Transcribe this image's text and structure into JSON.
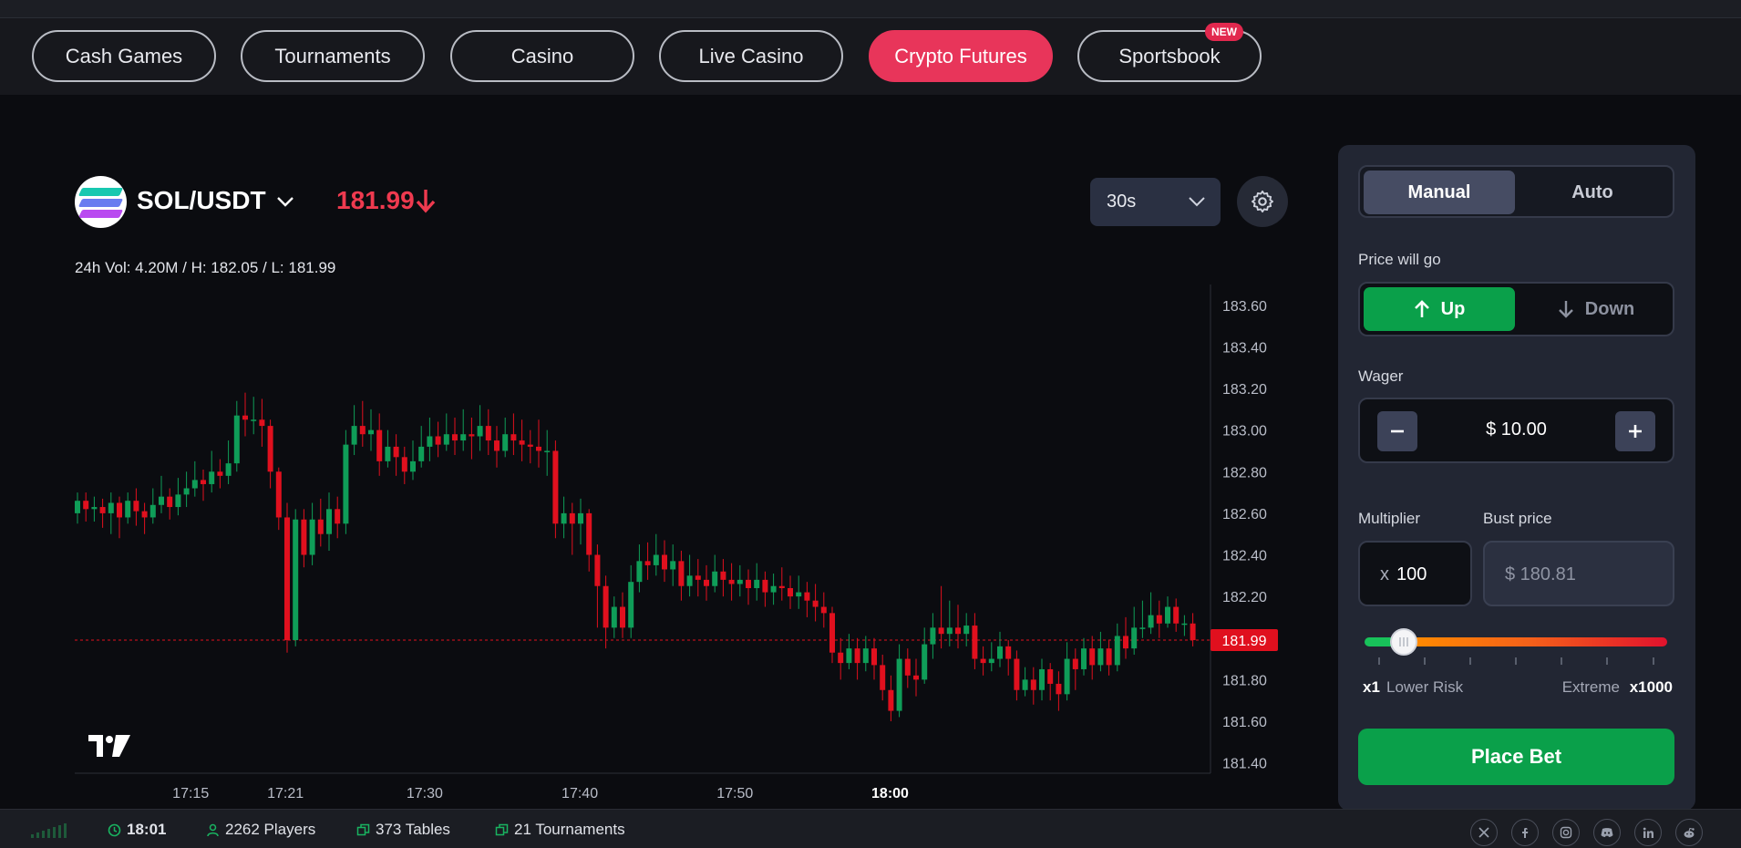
{
  "nav": {
    "tabs": [
      {
        "label": "Cash Games",
        "active": false
      },
      {
        "label": "Tournaments",
        "active": false
      },
      {
        "label": "Casino",
        "active": false
      },
      {
        "label": "Live Casino",
        "active": false
      },
      {
        "label": "Crypto Futures",
        "active": true
      },
      {
        "label": "Sportsbook",
        "active": false,
        "badge": "NEW"
      }
    ]
  },
  "symbol": {
    "pair": "SOL/USDT",
    "price": "181.99",
    "direction": "down",
    "stats": "24h Vol: 4.20M / H: 182.05 / L: 181.99",
    "timeframe": "30s"
  },
  "chart_data": {
    "type": "candlestick",
    "current_price": 181.99,
    "current_price_label": "181.99",
    "ylim": [
      181.35,
      183.7
    ],
    "y_ticks": [
      "183.60",
      "183.40",
      "183.20",
      "183.00",
      "182.80",
      "182.60",
      "182.40",
      "182.20",
      "181.80",
      "181.60",
      "181.40"
    ],
    "x_ticks": [
      {
        "label": "17:15",
        "bold": false
      },
      {
        "label": "17:21",
        "bold": false
      },
      {
        "label": "17:30",
        "bold": false
      },
      {
        "label": "17:40",
        "bold": false
      },
      {
        "label": "17:50",
        "bold": false
      },
      {
        "label": "18:00",
        "bold": true
      }
    ],
    "up_color": "#0f9d58",
    "down_color": "#e0101e",
    "candles": [
      [
        182.6,
        182.66,
        182.7,
        182.55
      ],
      [
        182.66,
        182.62,
        182.7,
        182.56
      ],
      [
        182.62,
        182.63,
        182.68,
        182.56
      ],
      [
        182.63,
        182.6,
        182.67,
        182.53
      ],
      [
        182.6,
        182.65,
        182.7,
        182.5
      ],
      [
        182.65,
        182.58,
        182.68,
        182.48
      ],
      [
        182.58,
        182.66,
        182.7,
        182.55
      ],
      [
        182.66,
        182.61,
        182.72,
        182.54
      ],
      [
        182.61,
        182.58,
        182.65,
        182.5
      ],
      [
        182.58,
        182.64,
        182.72,
        182.55
      ],
      [
        182.64,
        182.68,
        182.78,
        182.6
      ],
      [
        182.68,
        182.63,
        182.72,
        182.57
      ],
      [
        182.63,
        182.69,
        182.77,
        182.59
      ],
      [
        182.69,
        182.72,
        182.8,
        182.63
      ],
      [
        182.72,
        182.76,
        182.85,
        182.68
      ],
      [
        182.76,
        182.74,
        182.81,
        182.66
      ],
      [
        182.74,
        182.8,
        182.9,
        182.7
      ],
      [
        182.8,
        182.78,
        182.86,
        182.72
      ],
      [
        182.78,
        182.84,
        182.95,
        182.74
      ],
      [
        182.84,
        183.07,
        183.14,
        182.8
      ],
      [
        183.07,
        183.05,
        183.18,
        182.97
      ],
      [
        183.05,
        183.05,
        183.16,
        182.98
      ],
      [
        183.05,
        183.02,
        183.15,
        182.92
      ],
      [
        183.02,
        182.8,
        183.05,
        182.72
      ],
      [
        182.8,
        182.58,
        182.82,
        182.52
      ],
      [
        182.58,
        181.99,
        182.65,
        181.93
      ],
      [
        181.99,
        182.57,
        182.62,
        181.96
      ],
      [
        182.57,
        182.4,
        182.62,
        182.34
      ],
      [
        182.4,
        182.57,
        182.65,
        182.35
      ],
      [
        182.57,
        182.5,
        182.67,
        182.44
      ],
      [
        182.5,
        182.62,
        182.7,
        182.42
      ],
      [
        182.62,
        182.55,
        182.68,
        182.48
      ],
      [
        182.55,
        182.93,
        183.0,
        182.5
      ],
      [
        182.93,
        183.02,
        183.12,
        182.88
      ],
      [
        183.02,
        182.98,
        183.14,
        182.92
      ],
      [
        182.98,
        183.0,
        183.1,
        182.9
      ],
      [
        183.0,
        182.85,
        183.08,
        182.78
      ],
      [
        182.85,
        182.92,
        183.0,
        182.82
      ],
      [
        182.92,
        182.87,
        182.98,
        182.78
      ],
      [
        182.87,
        182.8,
        182.92,
        182.74
      ],
      [
        182.8,
        182.85,
        182.95,
        182.76
      ],
      [
        182.85,
        182.92,
        183.02,
        182.82
      ],
      [
        182.92,
        182.97,
        183.06,
        182.85
      ],
      [
        182.97,
        182.93,
        183.04,
        182.87
      ],
      [
        182.93,
        182.98,
        183.08,
        182.9
      ],
      [
        182.98,
        182.95,
        183.06,
        182.88
      ],
      [
        182.95,
        182.98,
        183.1,
        182.9
      ],
      [
        182.98,
        182.97,
        183.06,
        182.86
      ],
      [
        182.97,
        183.02,
        183.12,
        182.9
      ],
      [
        183.02,
        182.95,
        183.1,
        182.88
      ],
      [
        182.95,
        182.9,
        183.02,
        182.82
      ],
      [
        182.9,
        182.98,
        183.06,
        182.87
      ],
      [
        182.98,
        182.95,
        183.08,
        182.88
      ],
      [
        182.95,
        182.93,
        183.05,
        182.85
      ],
      [
        182.93,
        182.92,
        183.0,
        182.84
      ],
      [
        182.92,
        182.9,
        183.05,
        182.82
      ],
      [
        182.9,
        182.9,
        183.0,
        182.78
      ],
      [
        182.9,
        182.55,
        182.95,
        182.48
      ],
      [
        182.55,
        182.6,
        182.68,
        182.48
      ],
      [
        182.6,
        182.55,
        182.65,
        182.4
      ],
      [
        182.55,
        182.6,
        182.67,
        182.45
      ],
      [
        182.6,
        182.4,
        182.62,
        182.32
      ],
      [
        182.4,
        182.25,
        182.45,
        182.05
      ],
      [
        182.25,
        182.05,
        182.3,
        181.95
      ],
      [
        182.05,
        182.15,
        182.2,
        182.0
      ],
      [
        182.15,
        182.05,
        182.22,
        182.0
      ],
      [
        182.05,
        182.27,
        182.35,
        182.0
      ],
      [
        182.27,
        182.37,
        182.45,
        182.22
      ],
      [
        182.37,
        182.35,
        182.46,
        182.28
      ],
      [
        182.35,
        182.4,
        182.5,
        182.3
      ],
      [
        182.4,
        182.33,
        182.47,
        182.27
      ],
      [
        182.33,
        182.37,
        182.45,
        182.25
      ],
      [
        182.37,
        182.25,
        182.42,
        182.18
      ],
      [
        182.25,
        182.3,
        182.4,
        182.2
      ],
      [
        182.3,
        182.28,
        182.38,
        182.2
      ],
      [
        182.28,
        182.25,
        182.35,
        182.18
      ],
      [
        182.25,
        182.32,
        182.4,
        182.22
      ],
      [
        182.32,
        182.28,
        182.38,
        182.2
      ],
      [
        182.28,
        182.26,
        182.36,
        182.18
      ],
      [
        182.26,
        182.28,
        182.35,
        182.2
      ],
      [
        182.28,
        182.24,
        182.33,
        182.16
      ],
      [
        182.24,
        182.28,
        182.36,
        182.18
      ],
      [
        182.28,
        182.22,
        182.32,
        182.15
      ],
      [
        182.22,
        182.25,
        182.31,
        182.16
      ],
      [
        182.25,
        182.24,
        182.34,
        182.18
      ],
      [
        182.24,
        182.2,
        182.3,
        182.14
      ],
      [
        182.2,
        182.22,
        182.3,
        182.14
      ],
      [
        182.22,
        182.18,
        182.27,
        182.1
      ],
      [
        182.18,
        182.15,
        182.26,
        182.08
      ],
      [
        182.15,
        182.12,
        182.22,
        182.05
      ],
      [
        182.12,
        181.93,
        182.15,
        181.88
      ],
      [
        181.93,
        181.88,
        182.0,
        181.8
      ],
      [
        181.88,
        181.95,
        182.02,
        181.85
      ],
      [
        181.95,
        181.88,
        182.0,
        181.8
      ],
      [
        181.88,
        181.95,
        182.01,
        181.84
      ],
      [
        181.95,
        181.87,
        182.0,
        181.8
      ],
      [
        181.87,
        181.75,
        181.92,
        181.7
      ],
      [
        181.75,
        181.65,
        181.82,
        181.6
      ],
      [
        181.65,
        181.9,
        181.97,
        181.62
      ],
      [
        181.9,
        181.82,
        181.95,
        181.76
      ],
      [
        181.82,
        181.8,
        181.9,
        181.72
      ],
      [
        181.8,
        181.97,
        182.05,
        181.78
      ],
      [
        181.97,
        182.05,
        182.12,
        181.9
      ],
      [
        182.05,
        182.02,
        182.25,
        181.95
      ],
      [
        182.02,
        182.05,
        182.18,
        181.96
      ],
      [
        182.05,
        182.02,
        182.16,
        181.95
      ],
      [
        182.02,
        182.06,
        182.12,
        181.96
      ],
      [
        182.06,
        181.9,
        182.12,
        181.85
      ],
      [
        181.9,
        181.88,
        181.96,
        181.82
      ],
      [
        181.88,
        181.9,
        181.98,
        181.84
      ],
      [
        181.9,
        181.96,
        182.03,
        181.86
      ],
      [
        181.96,
        181.9,
        181.99,
        181.82
      ],
      [
        181.9,
        181.75,
        181.94,
        181.7
      ],
      [
        181.75,
        181.8,
        181.86,
        181.72
      ],
      [
        181.8,
        181.75,
        181.86,
        181.68
      ],
      [
        181.75,
        181.85,
        181.9,
        181.7
      ],
      [
        181.85,
        181.78,
        181.88,
        181.7
      ],
      [
        181.78,
        181.73,
        181.84,
        181.65
      ],
      [
        181.73,
        181.9,
        181.98,
        181.7
      ],
      [
        181.9,
        181.85,
        181.95,
        181.75
      ],
      [
        181.85,
        181.95,
        182.0,
        181.82
      ],
      [
        181.95,
        181.87,
        182.01,
        181.8
      ],
      [
        181.87,
        181.95,
        182.03,
        181.84
      ],
      [
        181.95,
        181.87,
        181.99,
        181.82
      ],
      [
        181.87,
        182.01,
        182.07,
        181.84
      ],
      [
        182.01,
        181.95,
        182.1,
        181.9
      ],
      [
        181.95,
        182.05,
        182.15,
        181.92
      ],
      [
        182.05,
        182.05,
        182.18,
        182.0
      ],
      [
        182.05,
        182.11,
        182.22,
        182.02
      ],
      [
        182.11,
        182.07,
        182.18,
        182.0
      ],
      [
        182.07,
        182.15,
        182.2,
        182.05
      ],
      [
        182.15,
        182.07,
        182.19,
        182.03
      ],
      [
        182.07,
        182.07,
        182.11,
        182.01
      ],
      [
        182.07,
        181.99,
        182.12,
        181.96
      ]
    ]
  },
  "panel": {
    "mode_tabs": [
      {
        "label": "Manual",
        "active": true
      },
      {
        "label": "Auto",
        "active": false
      }
    ],
    "direction_label": "Price will go",
    "up_label": "Up",
    "down_label": "Down",
    "wager_label": "Wager",
    "wager_value": "$ 10.00",
    "multiplier_label": "Multiplier",
    "multiplier_prefix": "x",
    "multiplier_value": "100",
    "bust_label": "Bust price",
    "bust_value": "$ 180.81",
    "risk_min_mult": "x1",
    "risk_min_label": "Lower Risk",
    "risk_max_label": "Extreme",
    "risk_max_mult": "x1000",
    "place_bet_label": "Place Bet"
  },
  "footer": {
    "time": "18:01",
    "players": "2262 Players",
    "tables": "373 Tables",
    "tournaments": "21 Tournaments",
    "social": [
      "x-icon",
      "facebook-icon",
      "instagram-icon",
      "discord-icon",
      "linkedin-icon",
      "reddit-icon"
    ]
  }
}
